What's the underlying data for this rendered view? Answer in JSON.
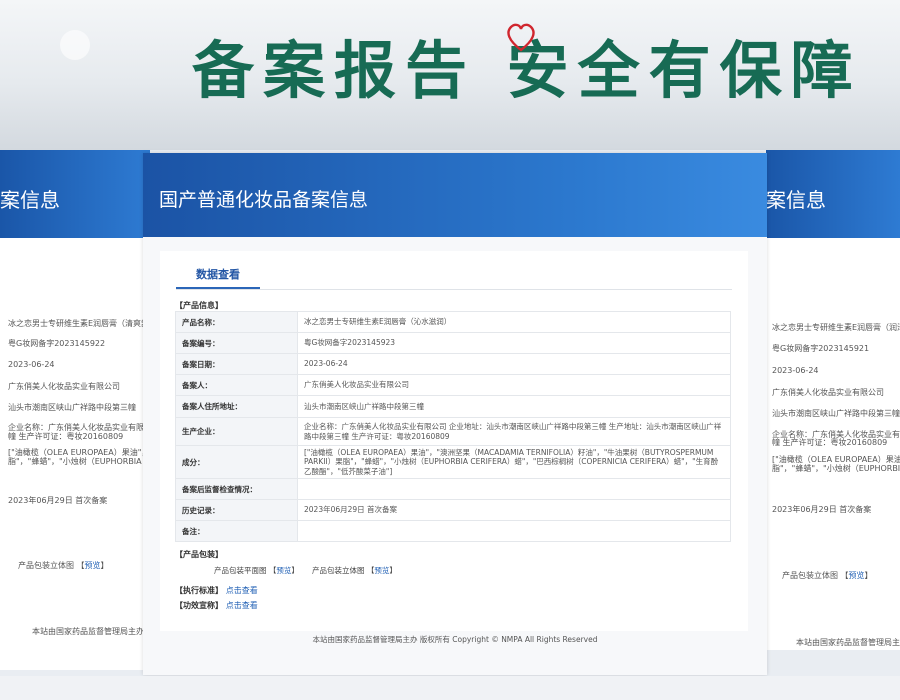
{
  "banner": {
    "slogan": "备案报告 安全有保障"
  },
  "left_panel": {
    "header_fragment": "案信息",
    "rows": [
      "冰之恋男士专研维生素E润唇膏（清爽舒润",
      "粤G妆网备字2023145922",
      "2023-06-24",
      "广东俏美人化妆品实业有限公司",
      "汕头市潮南区峡山广祥路中段第三幢",
      "企业名称：广东俏美人化妆品实业有限公司",
      "幢 生产许可证：粤妆20160809",
      "[\"油橄榄（OLEA EUROPAEA）果油\"，\"澳",
      "脂\"，\"蜂蜡\"，\"小烛树（EUPHORBIA CER",
      "2023年06月29日 首次备案"
    ],
    "package_label": "产品包装立体图",
    "preview": "预览",
    "footer": "本站由国家药品监督管理局主办 版"
  },
  "right_panel": {
    "header_fragment": "案信息",
    "rows": [
      "冰之恋男士专研维生素E润唇膏（润泽倍",
      "粤G妆网备字2023145921",
      "2023-06-24",
      "广东俏美人化妆品实业有限公司",
      "汕头市潮南区峡山广祥路中段第三幢",
      "企业名称：广东俏美人化妆品实业有限公",
      "幢 生产许可证：粤妆20160809",
      "[\"油橄榄（OLEA EUROPAEA）果油\"，\"",
      "脂\"，\"蜂蜡\"，\"小烛树（EUPHORBIA",
      "2023年06月29日 首次备案"
    ],
    "package_label": "产品包装立体图",
    "preview": "预览",
    "footer": "本站由国家药品监督管理局主办"
  },
  "main": {
    "title": "国产普通化妆品备案信息",
    "tab": "数据查看",
    "section_product": "【产品信息】",
    "fields": [
      {
        "label": "产品名称：",
        "value": "冰之恋男士专研维生素E润唇膏（沁水滋润）"
      },
      {
        "label": "备案编号：",
        "value": "粤G妆网备字2023145923"
      },
      {
        "label": "备案日期：",
        "value": "2023-06-24"
      },
      {
        "label": "备案人：",
        "value": "广东俏美人化妆品实业有限公司"
      },
      {
        "label": "备案人住所地址：",
        "value": "汕头市潮南区峡山广祥路中段第三幢"
      },
      {
        "label": "生产企业：",
        "value": "企业名称：广东俏美人化妆品实业有限公司 企业地址：汕头市潮南区峡山广祥路中段第三幢 生产地址：汕头市潮南区峡山广祥路中段第三幢 生产许可证：粤妆20160809"
      },
      {
        "label": "成分：",
        "value": "[\"油橄榄（OLEA EUROPAEA）果油\"，\"澳洲坚果（MACADAMIA TERNIFOLIA）籽油\"，\"牛油果树（BUTYROSPERMUM PARKII）果脂\"，\"蜂蜡\"，\"小烛树（EUPHORBIA CERIFERA）蜡\"，\"巴西棕榈树（COPERNICIA CERIFERA）蜡\"，\"生育酚乙酸酯\"，\"低芥酸菜子油\"]"
      },
      {
        "label": "备案后监督检查情况：",
        "value": ""
      },
      {
        "label": "历史记录：",
        "value": "2023年06月29日 首次备案"
      },
      {
        "label": "备注：",
        "value": ""
      }
    ],
    "section_package": "【产品包装】",
    "package_flat": "产品包装平面图",
    "package_3d": "产品包装立体图",
    "preview": "预览",
    "section_standard": "【执行标准】",
    "section_efficacy": "【功效宣称】",
    "click_view": "点击查看",
    "footer": "本站由国家药品监督管理局主办 版权所有 Copyright © NMPA All Rights Reserved"
  },
  "colors": {
    "header_blue": "#1b53a5",
    "slogan_green": "#176b54",
    "link_blue": "#1f5fb4"
  }
}
